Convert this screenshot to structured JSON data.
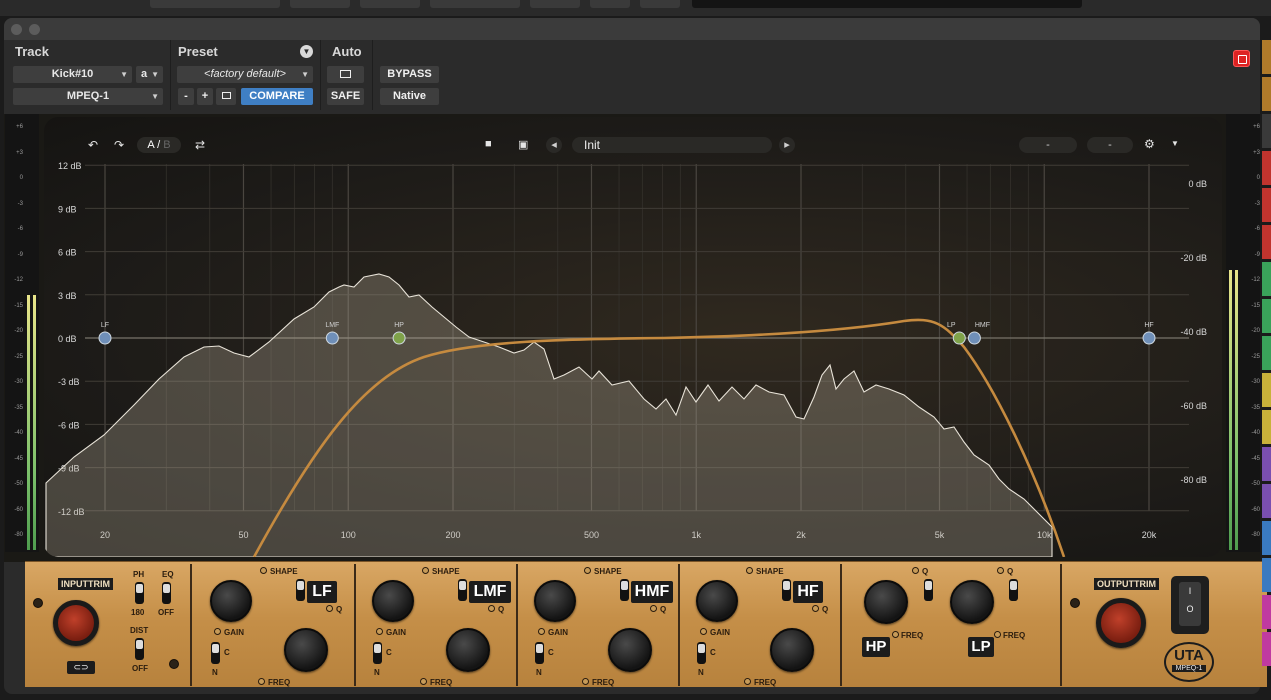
{
  "header": {
    "track_label": "Track",
    "preset_label": "Preset",
    "auto_label": "Auto",
    "track_name": "Kick#10",
    "track_channel": "a",
    "plugin_name": "MPEQ-1",
    "preset_name": "<factory default>",
    "minus": "-",
    "plus": "+",
    "compare": "COMPARE",
    "safe": "SAFE",
    "bypass": "BYPASS",
    "native": "Native"
  },
  "toolbar": {
    "ab_a": "A",
    "ab_sep": "/",
    "ab_b": "B",
    "preset_name": "Init",
    "slot1": "-",
    "slot2": "-"
  },
  "eq": {
    "gain_labels": [
      "12 dB",
      "9 dB",
      "6 dB",
      "3 dB",
      "0 dB",
      "-3 dB",
      "-6 dB",
      "-9 dB",
      "-12 dB"
    ],
    "analyzer_labels": [
      "0 dB",
      "-20 dB",
      "-40 dB",
      "-60 dB",
      "-80 dB"
    ],
    "freq_labels": [
      "20",
      "50",
      "100",
      "200",
      "500",
      "1k",
      "2k",
      "5k",
      "10k",
      "20k"
    ],
    "nodes": [
      {
        "label": "LF",
        "freq_hz": 20,
        "color": "#6f8fb8"
      },
      {
        "label": "LMF",
        "freq_hz": 90,
        "color": "#6f8fb8"
      },
      {
        "label": "HP",
        "freq_hz": 140,
        "color": "#7fa24a"
      },
      {
        "label": "LP",
        "freq_hz": 5700,
        "color": "#7fa24a"
      },
      {
        "label": "HMF",
        "freq_hz": 6300,
        "color": "#6f8fb8"
      },
      {
        "label": "HF",
        "freq_hz": 20000,
        "color": "#6f8fb8"
      }
    ],
    "accent": "#c58a3f"
  },
  "meters": {
    "scale": [
      "+6",
      "+3",
      "0",
      "-3",
      "-6",
      "-9",
      "-12",
      "-15",
      "-20",
      "-25",
      "-30",
      "-35",
      "-40",
      "-45",
      "-50",
      "-60",
      "-80"
    ],
    "left_level_db": -12,
    "right_level_db": -9
  },
  "hardware": {
    "input_trim": "INPUTTRIM",
    "ph": "PH",
    "ph_val": "180",
    "eq": "EQ",
    "eq_val": "OFF",
    "dist": "DIST",
    "dist_val": "OFF",
    "shape": "SHAPE",
    "gain": "GAIN",
    "freq": "FREQ",
    "q": "Q",
    "c": "C",
    "n": "N",
    "bands": [
      "LF",
      "LMF",
      "HMF",
      "HF"
    ],
    "hp": "HP",
    "lp": "LP",
    "output_trim": "OUTPUTTRIM",
    "brand": "UTA",
    "model": "MPEQ-1",
    "power_on": "I",
    "power_off": "O"
  }
}
